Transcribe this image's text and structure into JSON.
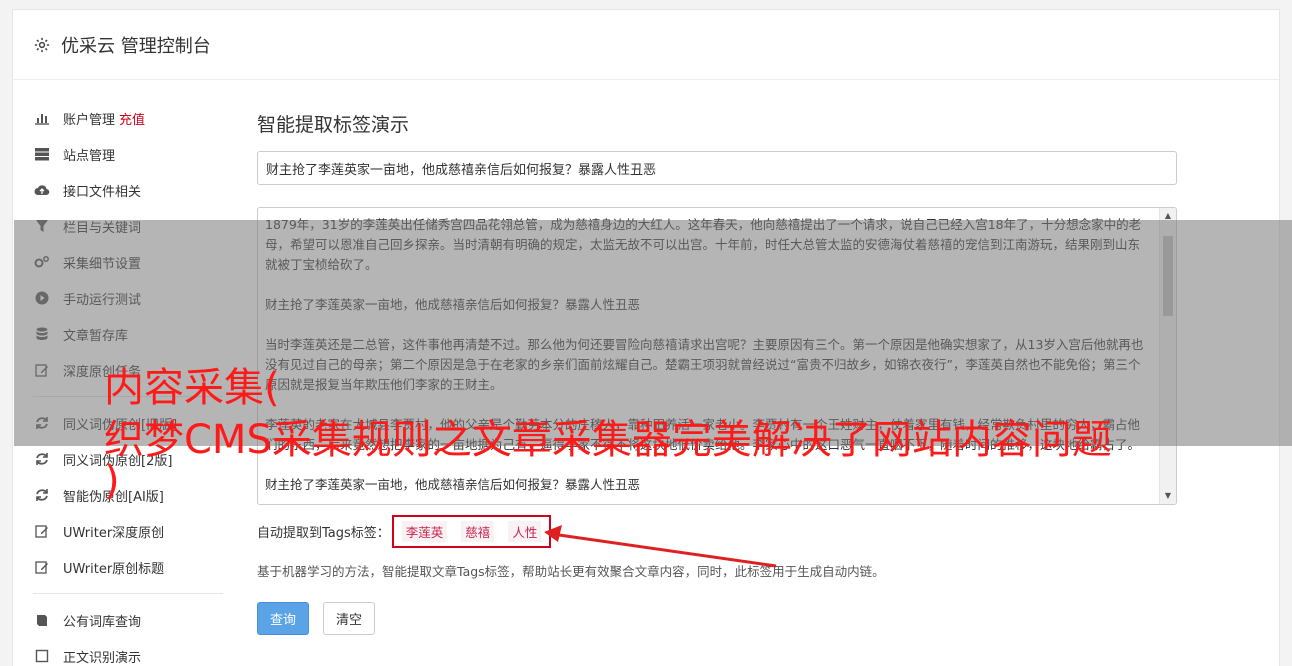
{
  "header": {
    "title": "优采云 管理控制台",
    "icon": "gear-icon"
  },
  "sidebar": {
    "items": [
      {
        "label": "账户管理",
        "extra": "充值",
        "icon": "bar-chart-icon"
      },
      {
        "label": "站点管理",
        "icon": "server-icon"
      },
      {
        "label": "接口文件相关",
        "icon": "cloud-upload-icon"
      },
      {
        "label": "栏目与关键词",
        "icon": "filter-icon"
      },
      {
        "label": "采集细节设置",
        "icon": "cogs-icon"
      },
      {
        "label": "手动运行测试",
        "icon": "play-icon"
      },
      {
        "label": "文章暂存库",
        "icon": "database-icon"
      },
      {
        "label": "深度原创任务",
        "icon": "edit-icon"
      },
      {
        "label": "同义词伪原创[旧版]",
        "icon": "refresh-icon"
      },
      {
        "label": "同义词伪原创[2版]",
        "icon": "refresh-icon"
      },
      {
        "label": "智能伪原创[AI版]",
        "icon": "refresh-icon"
      },
      {
        "label": "UWriter深度原创",
        "icon": "edit-icon"
      },
      {
        "label": "UWriter原创标题",
        "icon": "edit-icon"
      },
      {
        "label": "公有词库查询",
        "icon": "book-icon"
      },
      {
        "label": "正文识别演示",
        "icon": "square-icon"
      }
    ]
  },
  "main": {
    "heading": "智能提取标签演示",
    "title_value": "财主抢了李莲英家一亩地，他成慈禧亲信后如何报复？暴露人性丑恶",
    "paragraphs": [
      "1879年，31岁的李莲英出任储秀宫四品花翎总管，成为慈禧身边的大红人。这年春天，他向慈禧提出了一个请求，说自己已经入宫18年了，十分想念家中的老母，希望可以恩准自己回乡探亲。当时清朝有明确的规定，太监无故不可以出宫。十年前，时任大总管太监的安德海仗着慈禧的宠信到江南游玩，结果刚到山东就被丁宝桢给砍了。",
      "财主抢了李莲英家一亩地，他成慈禧亲信后如何报复？暴露人性丑恶",
      "当时李莲英还是二总管，这件事他再清楚不过。那么他为何还要冒险向慈禧请求出宫呢？主要原因有三个。第一个原因是他确实想家了，从13岁入宫后他就再也没有见过自己的母亲；第二个原因是急于在老家的乡亲们面前炫耀自己。楚霸王项羽就曾经说过“富贵不归故乡，如锦衣夜行”，李莲英自然也不能免俗；第三个原因就是报复当年欺压他们李家的王财主。",
      "李莲英的老家在大城县李贾村，他的父亲是个勤劳本分的庄稼人，靠种田养活一家老小。李贾村有一个王姓财主，仗着家里有钱，经常欺负村里的穷人，霸占他们的东西，后来竟然想把李家的一亩地据为己有，逼得李家不得不将这块地低价卖给他。李家心中的这口恶气一直咽不下，随着时间的推移，这块地给霸占了。",
      "财主抢了李莲英家一亩地，他成慈禧亲信后如何报复？暴露人性丑恶"
    ],
    "tags_label": "自动提取到Tags标签：",
    "tags": [
      "李莲英",
      "慈禧",
      "人性"
    ],
    "description": "基于机器学习的方法，智能提取文章Tags标签，帮助站长更有效聚合文章内容，同时，此标签用于生成自动内链。",
    "query_button": "查询",
    "clear_button": "清空"
  },
  "overlay": {
    "lines": [
      "内容采集(",
      "织梦CMS采集规则之文章采集器完美解决了网站内容问题",
      ")"
    ]
  },
  "colors": {
    "accent": "#5aa3e6",
    "highlight": "#d0021b",
    "overlay_text": "#ff1a1a"
  }
}
